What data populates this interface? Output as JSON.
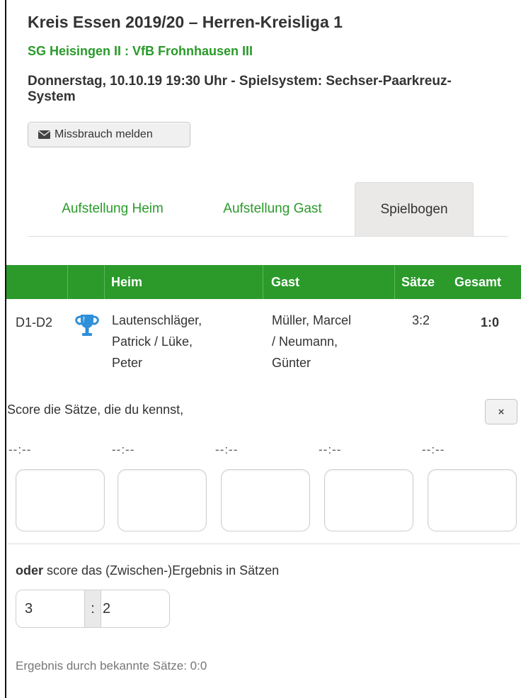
{
  "header": {
    "title": "Kreis Essen 2019/20 – Herren-Kreisliga 1",
    "match": "SG Heisingen II : VfB Frohnhausen III",
    "date_line": "Donnerstag, 10.10.19 19:30 Uhr - Spielsystem: Sechser-Paarkreuz-System"
  },
  "report_button": {
    "label": "Missbrauch melden",
    "icon": "envelope-icon"
  },
  "tabs": [
    {
      "label": "Aufstellung Heim",
      "active": false
    },
    {
      "label": "Aufstellung Gast",
      "active": false
    },
    {
      "label": "Spielbogen",
      "active": true
    }
  ],
  "table": {
    "headers": [
      "Heim",
      "Gast",
      "Sätze",
      "Gesamt"
    ],
    "header_color": "#2b9a2b",
    "row": {
      "pair": "D1-D2",
      "icon": "trophy-icon",
      "home_lines": [
        "Lautenschläger,",
        "Patrick / Lüke,",
        "Peter"
      ],
      "guest_lines": [
        "Müller, Marcel",
        "/ Neumann,",
        "Günter"
      ],
      "sets": "3:2",
      "total": "1:0"
    }
  },
  "score_form": {
    "prompt": "Score die Sätze, die du kennst,",
    "close_label": "×",
    "set_labels": [
      "--:--",
      "--:--",
      "--:--",
      "--:--",
      "--:--"
    ],
    "set_values": [
      "",
      "",
      "",
      "",
      ""
    ],
    "or_bold": "oder",
    "or_rest": " score das (Zwischen-)Ergebnis in Sätzen",
    "result_home": "3",
    "result_separator": ":",
    "result_guest": "2",
    "known_sets_text": "Ergebnis durch bekannte Sätze: 0:0"
  }
}
